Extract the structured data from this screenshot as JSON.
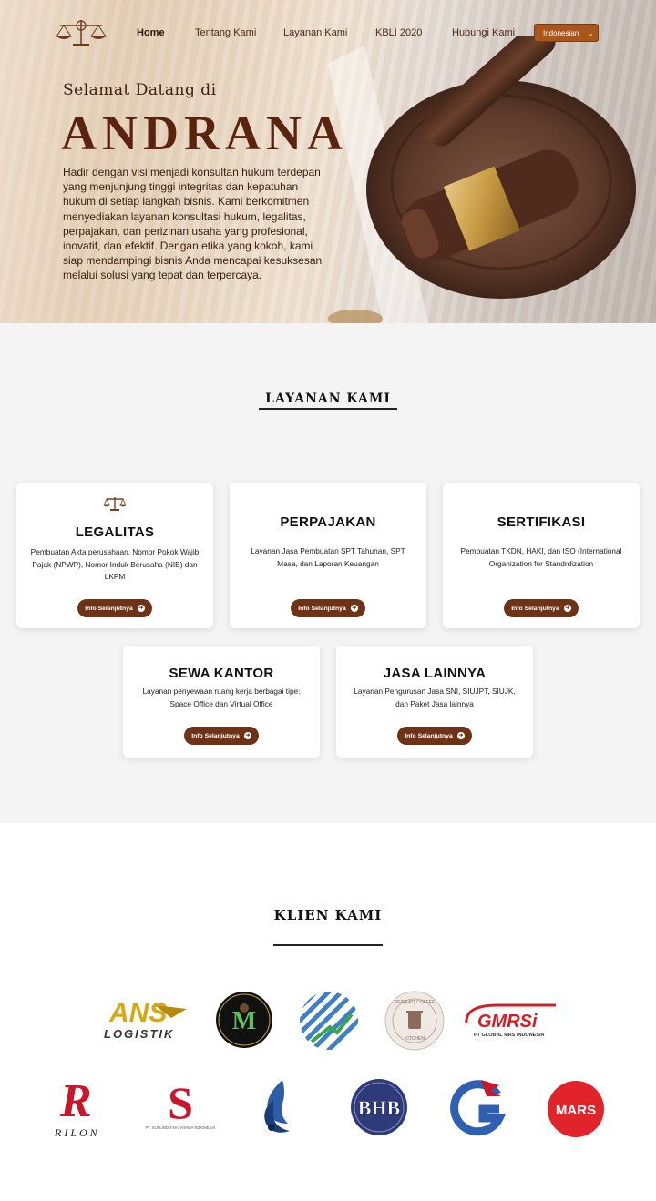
{
  "nav": {
    "items": [
      {
        "label": "Home",
        "active": true
      },
      {
        "label": "Tentang Kami",
        "active": false
      },
      {
        "label": "Layanan Kami",
        "active": false
      },
      {
        "label": "KBLI 2020",
        "active": false
      },
      {
        "label": "Hubungi Kami",
        "active": false
      }
    ],
    "language": "Indonesian"
  },
  "hero": {
    "welcome": "Selamat Datang di",
    "brand": "ANDRANA",
    "description": "Hadir dengan visi menjadi konsultan hukum terdepan yang menjunjung tinggi integritas dan kepatuhan hukum di setiap langkah bisnis. Kami berkomitmen menyediakan layanan konsultasi hukum, legalitas, perpajakan, dan perizinan usaha yang profesional, inovatif, dan efektif. Dengan etika yang kokoh, kami siap mendampingi bisnis Anda mencapai kesuksesan melalui solusi yang tepat dan terpercaya."
  },
  "services": {
    "title": "LAYANAN KAMI",
    "button_label": "Info Selanjutnya",
    "cards": [
      {
        "title": "LEGALITAS",
        "description": "Pembuatan Akta perusahaan, Nomor Pokok Wajib Pajak (NPWP), Nomor Induk Berusaha (NIB) dan LKPM",
        "icon": "scales-icon"
      },
      {
        "title": "PERPAJAKAN",
        "description": "Layanan Jasa Pembuatan SPT Tahunan, SPT Masa, dan Laporan Keuangan"
      },
      {
        "title": "SERTIFIKASI",
        "description": "Pembuatan TKDN, HAKI, dan ISO (International Organization for Standrdization"
      },
      {
        "title": "SEWA KANTOR",
        "description": "Layanan penyewaan ruang kerja berbagai tipe: Space Office dan Virtual Office"
      },
      {
        "title": "JASA LAINNYA",
        "description": "Layanan Pengurusan Jasa SNI, SIUJPT, SIUJK, dan Paket Jasa lainnya"
      }
    ]
  },
  "clients": {
    "title": "KLIEN KAMI",
    "logos": [
      {
        "name": "ans-logistik-logo",
        "text_main": "ANS",
        "text_sub": "LOGISTIK"
      },
      {
        "name": "m-circle-logo",
        "text_main": "M"
      },
      {
        "name": "blue-growth-logo"
      },
      {
        "name": "repeat-coffee-logo",
        "text_main": "REP(EAT) COFFEE",
        "text_sub": "KITCHEN"
      },
      {
        "name": "gmrs-logo",
        "text_main": "GMRSi",
        "text_sub": "PT GLOBAL MRS INDONESIA"
      },
      {
        "name": "rilon-logo",
        "text_main": "R",
        "text_sub": "RILON"
      },
      {
        "name": "suplindo-logo",
        "text_main": "S",
        "text_sub": "PT. SUPLINDO MAHATAMA INDONESIA"
      },
      {
        "name": "drop-logo"
      },
      {
        "name": "bhb-logo",
        "text_main": "BHB"
      },
      {
        "name": "dragon-g-logo",
        "text_main": "G"
      },
      {
        "name": "mars-logo",
        "text_main": "MARS"
      }
    ]
  },
  "colors": {
    "brand_brown": "#6e3216",
    "lang_button": "#a8561c",
    "hero_text": "#5a2310"
  }
}
